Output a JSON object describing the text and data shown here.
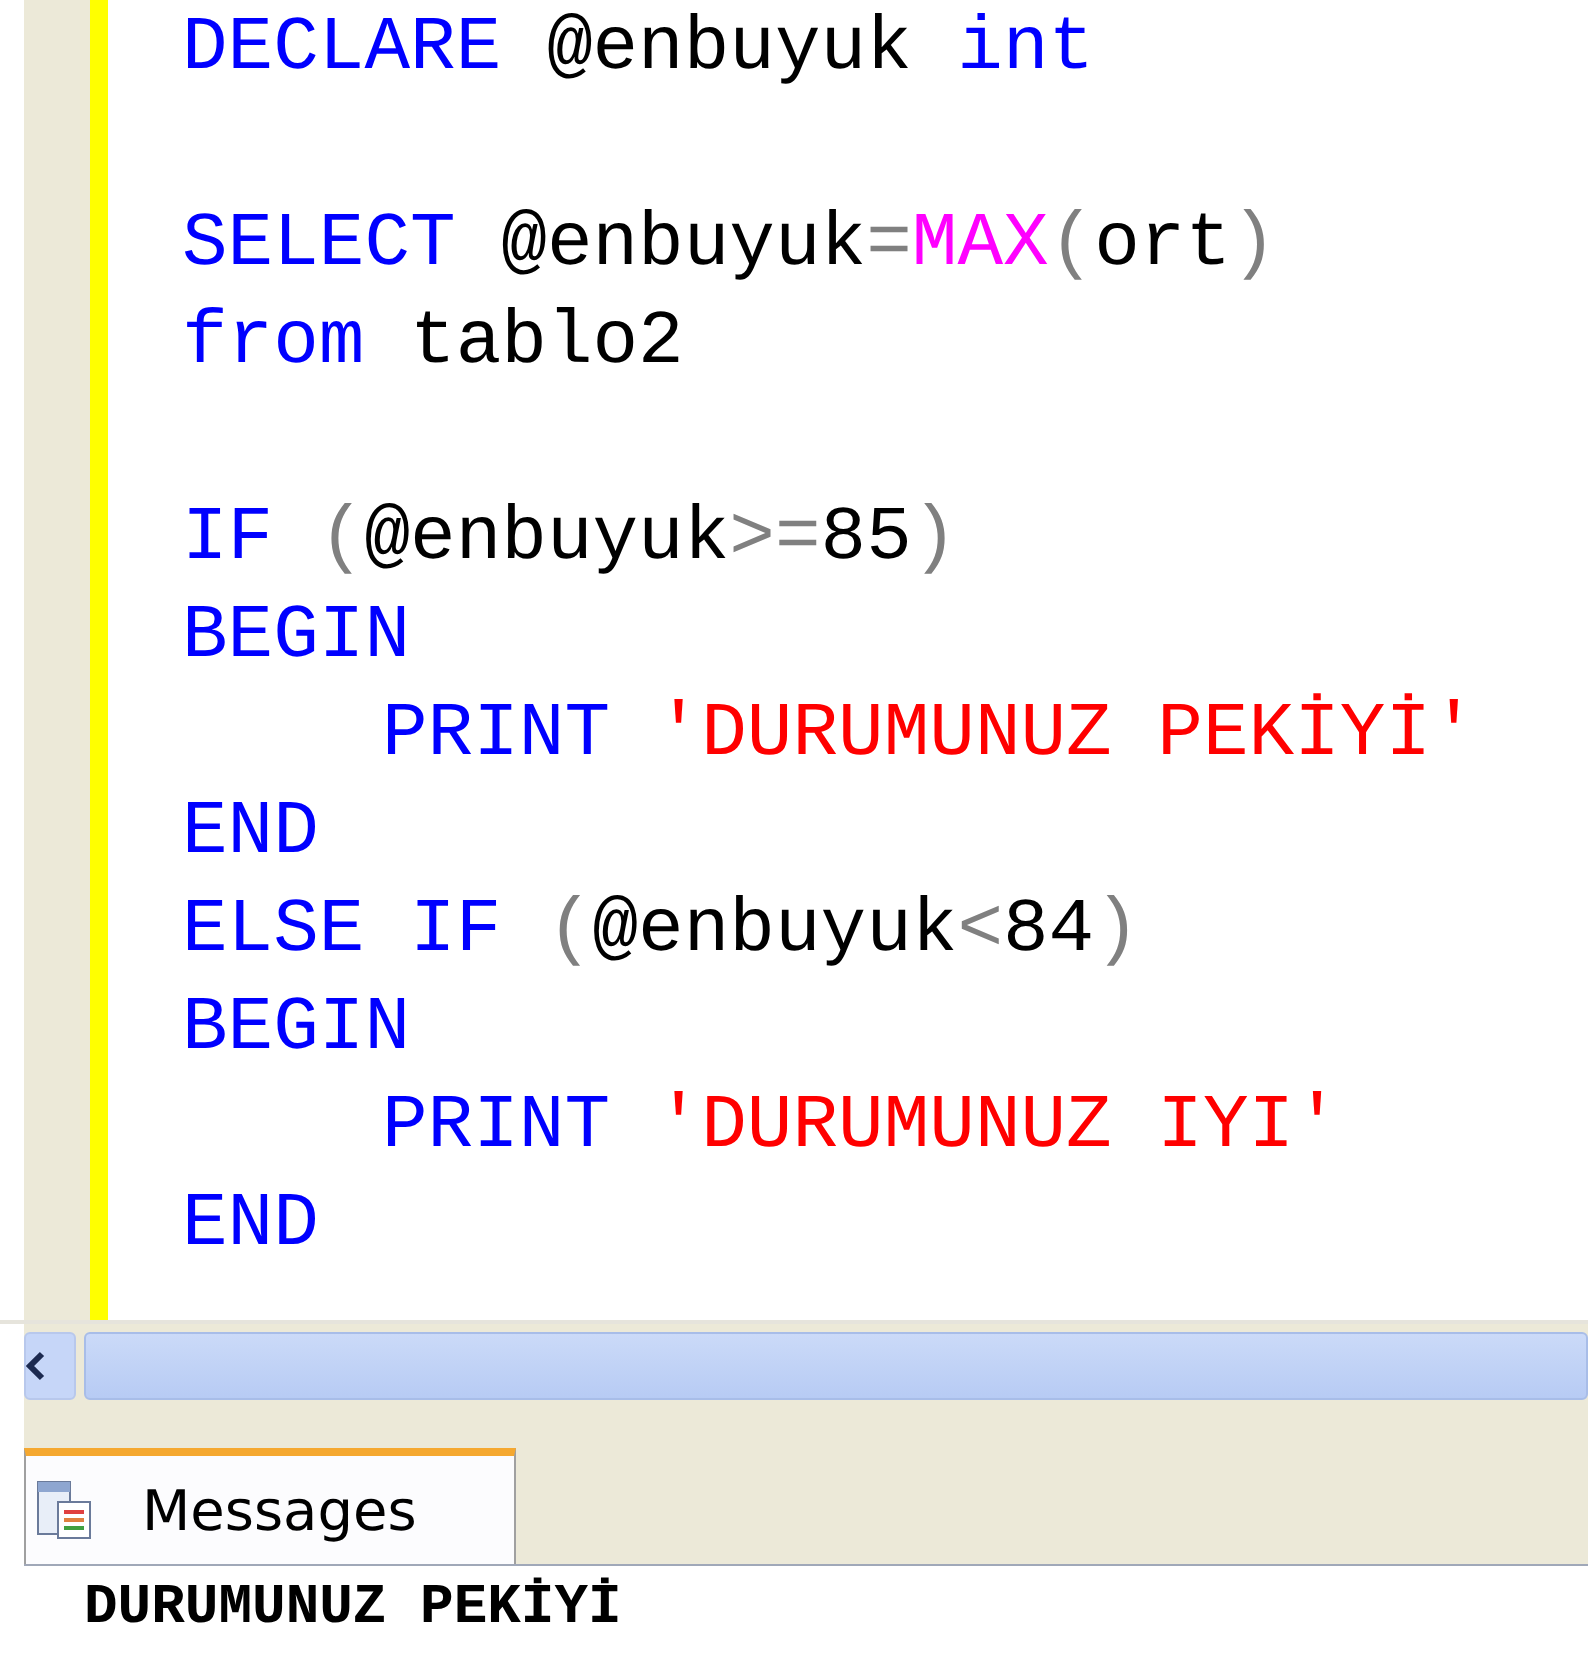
{
  "editor": {
    "lines": [
      {
        "kind": "code",
        "indent": false,
        "tokens": [
          {
            "kind": "keyword",
            "text": "DECLARE "
          },
          {
            "kind": "plain",
            "text": "@enbuyuk "
          },
          {
            "kind": "keyword",
            "text": "int"
          }
        ]
      },
      {
        "kind": "blank"
      },
      {
        "kind": "code",
        "indent": false,
        "tokens": [
          {
            "kind": "keyword",
            "text": "SELECT "
          },
          {
            "kind": "plain",
            "text": "@enbuyuk"
          },
          {
            "kind": "operator",
            "text": "="
          },
          {
            "kind": "function",
            "text": "MAX"
          },
          {
            "kind": "operator",
            "text": "("
          },
          {
            "kind": "plain",
            "text": "ort"
          },
          {
            "kind": "operator",
            "text": ")"
          }
        ]
      },
      {
        "kind": "code",
        "indent": false,
        "tokens": [
          {
            "kind": "keyword",
            "text": "from "
          },
          {
            "kind": "plain",
            "text": "tablo2"
          }
        ]
      },
      {
        "kind": "blank"
      },
      {
        "kind": "code",
        "indent": false,
        "tokens": [
          {
            "kind": "keyword",
            "text": "IF "
          },
          {
            "kind": "operator",
            "text": "("
          },
          {
            "kind": "plain",
            "text": "@enbuyuk"
          },
          {
            "kind": "operator",
            "text": ">="
          },
          {
            "kind": "plain",
            "text": "85"
          },
          {
            "kind": "operator",
            "text": ")"
          }
        ]
      },
      {
        "kind": "code",
        "indent": false,
        "tokens": [
          {
            "kind": "keyword",
            "text": "BEGIN"
          }
        ]
      },
      {
        "kind": "code",
        "indent": true,
        "tokens": [
          {
            "kind": "keyword",
            "text": "PRINT "
          },
          {
            "kind": "string",
            "text": "'DURUMUNUZ PEKİYİ'"
          }
        ]
      },
      {
        "kind": "code",
        "indent": false,
        "tokens": [
          {
            "kind": "keyword",
            "text": "END"
          }
        ]
      },
      {
        "kind": "code",
        "indent": false,
        "tokens": [
          {
            "kind": "keyword",
            "text": "ELSE IF "
          },
          {
            "kind": "operator",
            "text": "("
          },
          {
            "kind": "plain",
            "text": "@enbuyuk"
          },
          {
            "kind": "operator",
            "text": "<"
          },
          {
            "kind": "plain",
            "text": "84"
          },
          {
            "kind": "operator",
            "text": ")"
          }
        ]
      },
      {
        "kind": "code",
        "indent": false,
        "tokens": [
          {
            "kind": "keyword",
            "text": "BEGIN"
          }
        ]
      },
      {
        "kind": "code",
        "indent": true,
        "tokens": [
          {
            "kind": "keyword",
            "text": "PRINT "
          },
          {
            "kind": "string",
            "text": "'DURUMUNUZ IYI'"
          }
        ]
      },
      {
        "kind": "code",
        "indent": false,
        "tokens": [
          {
            "kind": "keyword",
            "text": "END"
          }
        ]
      }
    ]
  },
  "results": {
    "tabs": [
      {
        "label": "Messages",
        "selected": true
      }
    ],
    "output": "DURUMUNUZ PEKİYİ"
  }
}
